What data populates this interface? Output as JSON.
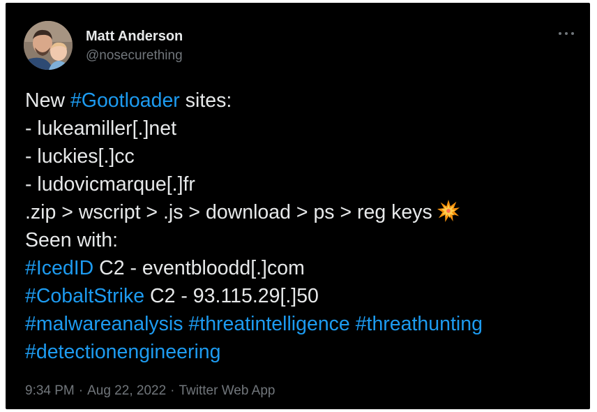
{
  "tweet": {
    "author": {
      "name": "Matt Anderson",
      "handle": "@nosecurething"
    },
    "menu_icon": "more-horizontal-icon",
    "lines": [
      {
        "parts": [
          {
            "t": "New ",
            "tag": false
          },
          {
            "t": "#Gootloader",
            "tag": true
          },
          {
            "t": " sites:",
            "tag": false
          }
        ]
      },
      {
        "parts": [
          {
            "t": "- lukeamiller[.]net",
            "tag": false
          }
        ]
      },
      {
        "parts": [
          {
            "t": "- luckies[.]cc",
            "tag": false
          }
        ]
      },
      {
        "parts": [
          {
            "t": "- ludovicmarque[.]fr",
            "tag": false
          }
        ]
      },
      {
        "parts": [
          {
            "t": ".zip > wscript > .js > download > ps > reg keys",
            "tag": false
          }
        ],
        "emoji": "collision-emoji-icon"
      },
      {
        "parts": [
          {
            "t": "Seen with:",
            "tag": false
          }
        ]
      },
      {
        "parts": [
          {
            "t": "#IcedID",
            "tag": true
          },
          {
            "t": " C2 - eventbloodd[.]com",
            "tag": false
          }
        ]
      },
      {
        "parts": [
          {
            "t": "#CobaltStrike",
            "tag": true
          },
          {
            "t": " C2 - 93.115.29[.]50",
            "tag": false
          }
        ]
      },
      {
        "parts": [
          {
            "t": "#malwareanalysis",
            "tag": true
          },
          {
            "t": " ",
            "tag": false
          },
          {
            "t": "#threatintelligence",
            "tag": true
          },
          {
            "t": " ",
            "tag": false
          },
          {
            "t": "#threathunting",
            "tag": true
          }
        ]
      },
      {
        "parts": [
          {
            "t": "#detectionengineering",
            "tag": true
          }
        ]
      }
    ],
    "meta": {
      "time": "9:34 PM",
      "date": "Aug 22, 2022",
      "source": "Twitter Web App",
      "separator": "·"
    }
  },
  "colors": {
    "background": "#000000",
    "text": "#e7e9ea",
    "hashtag": "#1d9bf0",
    "muted": "#71767b"
  }
}
